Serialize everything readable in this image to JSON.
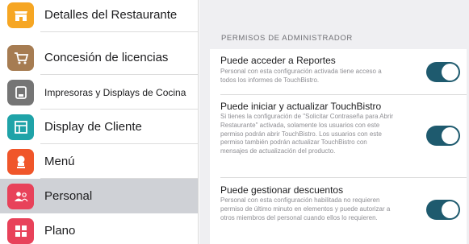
{
  "sidebar": {
    "items": [
      {
        "label": "Detalles del Restaurante",
        "icon": "storefront-icon",
        "color": "#f6a623",
        "active": false
      },
      {
        "label": "Concesión de licencias",
        "icon": "cart-icon",
        "color": "#a67c52",
        "active": false
      },
      {
        "label": "Impresoras y Displays de Cocina",
        "icon": "printer-icon",
        "color": "#757575",
        "active": false
      },
      {
        "label": "Display de Cliente",
        "icon": "display-icon",
        "color": "#1fa3a8",
        "active": false
      },
      {
        "label": "Menú",
        "icon": "chef-icon",
        "color": "#f0562a",
        "active": false
      },
      {
        "label": "Personal",
        "icon": "people-icon",
        "color": "#e8425a",
        "active": true
      },
      {
        "label": "Plano",
        "icon": "floorplan-icon",
        "color": "#e8425a",
        "active": false
      }
    ]
  },
  "main": {
    "section_title": "PERMISOS DE ADMINISTRADOR",
    "permissions": [
      {
        "title": "Puede acceder a Reportes",
        "description": "Personal con esta configuración activada tiene acceso a todos los informes de TouchBistro.",
        "enabled": true
      },
      {
        "title": "Puede iniciar y actualizar TouchBistro",
        "description": "Si tienes la configuración de \"Solicitar Contraseña para Abrir Restaurante\" activada, solamente los usuarios con este permiso podrán abrir TouchBistro. Los usuarios con este permiso también podrán actualizar TouchBistro con mensajes de actualización del producto.",
        "enabled": true
      },
      {
        "title": "Puede gestionar descuentos",
        "description": "Personal con esta configuración habilitada no requieren permiso de último minuto en elementos y puede autorizar a otros miembros del personal cuando ellos lo requieren.",
        "enabled": true
      }
    ]
  },
  "colors": {
    "toggle_on": "#1e5a6e",
    "active_row": "#cfd1d6"
  }
}
